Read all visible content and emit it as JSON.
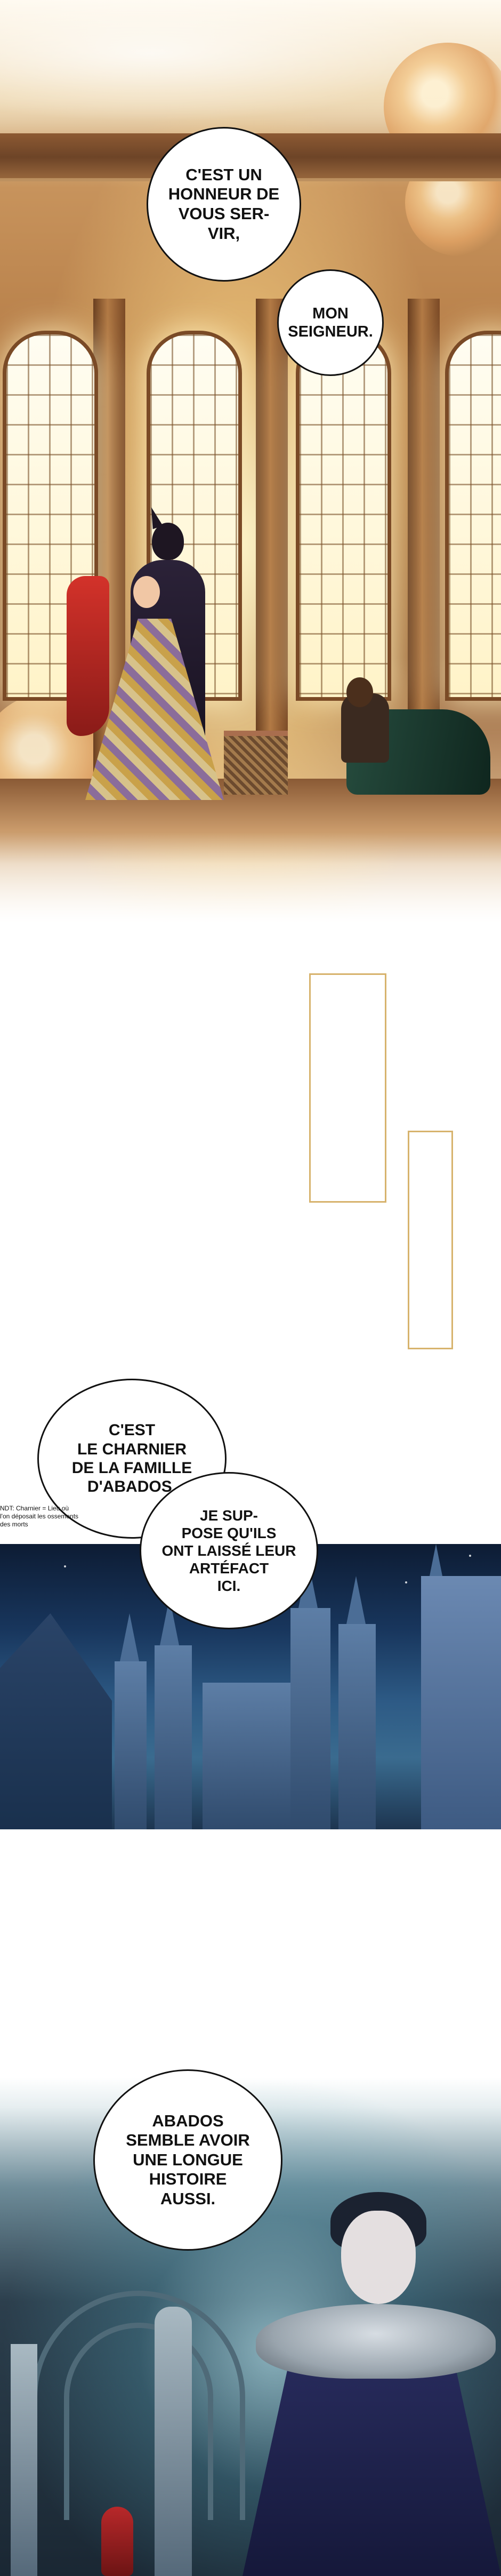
{
  "panel1": {
    "bubble_top": "C'EST UN\nHONNEUR DE\nVOUS SER-\nVIR,",
    "bubble_second": "MON\nSEIGNEUR."
  },
  "panel2": {
    "bubble_first": "C'EST\nLE CHARNIER\nDE LA FAMILLE\nD'ABADOS.",
    "bubble_second": "JE SUP-\nPOSE QU'ILS\nONT LAISSÉ LEUR\nARTÉFACT\nICI.",
    "translator_note": "NDT: Charnier = Lieu où l'on déposait les ossements des morts"
  },
  "panel3": {
    "bubble": "ABADOS\nSEMBLE AVOIR\nUNE LONGUE\nHISTOIRE\nAUSSI."
  }
}
